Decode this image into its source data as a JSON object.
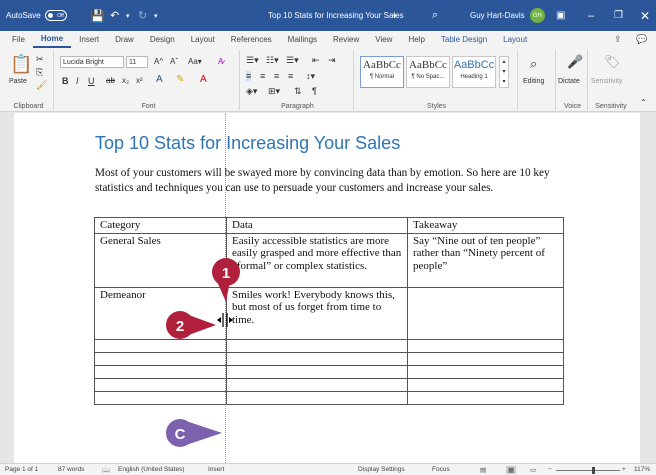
{
  "titlebar": {
    "autosave_label": "AutoSave",
    "autosave_state": "Off",
    "doc_title": "Top 10 Stats for Increasing Your Sales",
    "user_name": "Guy Hart-Davis",
    "user_initials": "GH"
  },
  "menu": {
    "tabs": [
      "File",
      "Home",
      "Insert",
      "Draw",
      "Design",
      "Layout",
      "References",
      "Mailings",
      "Review",
      "View",
      "Help",
      "Table Design",
      "Layout"
    ],
    "active": "Home"
  },
  "ribbon": {
    "clipboard": {
      "label": "Clipboard",
      "paste": "Paste"
    },
    "font": {
      "label": "Font",
      "name": "Lucida Bright",
      "size": "11"
    },
    "paragraph": {
      "label": "Paragraph"
    },
    "styles": {
      "label": "Styles",
      "items": [
        {
          "preview": "AaBbCc",
          "name": "¶ Normal"
        },
        {
          "preview": "AaBbCc",
          "name": "¶ No Spac..."
        },
        {
          "preview": "AaBbCc",
          "name": "Heading 1"
        }
      ]
    },
    "editing": {
      "label": "Editing"
    },
    "voice": {
      "label": "Voice",
      "dictate": "Dictate"
    },
    "sensitivity": {
      "label": "Sensitivity",
      "button": "Sensitivity"
    }
  },
  "document": {
    "title": "Top 10 Stats for Increasing Your Sales",
    "paragraph": "Most of your customers will be swayed more by convincing data than by emotion. So here are 10 key statistics and techniques you can use to persuade your customers and increase your sales.",
    "table": {
      "headers": [
        "Category",
        "Data",
        "Takeaway"
      ],
      "rows": [
        [
          "General Sales",
          "Easily accessible statistics are more easily grasped and more effective than “formal” or complex statistics.",
          "Say “Nine out of ten people” rather than “Ninety percent of people”"
        ],
        [
          "Demeanor",
          "Smiles work! Everybody knows this, but most of us forget from time to time.",
          ""
        ]
      ]
    }
  },
  "callouts": {
    "one": "1",
    "two": "2",
    "c": "C",
    "color": "#b01f3c",
    "c_color": "#7b61ae"
  },
  "statusbar": {
    "page": "Page 1 of 1",
    "words": "87 words",
    "language": "English (United States)",
    "mode": "Insert",
    "display_settings": "Display Settings",
    "focus": "Focus",
    "zoom": "117%"
  }
}
